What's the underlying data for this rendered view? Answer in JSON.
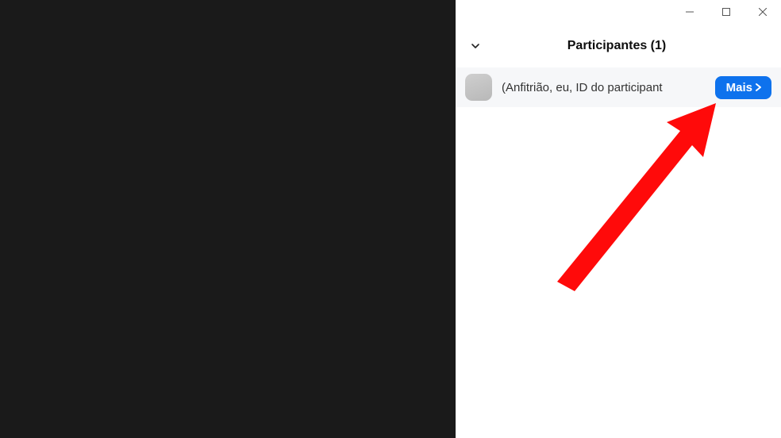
{
  "panel": {
    "title": "Participantes (1)"
  },
  "participants": [
    {
      "label": "(Anfitrião, eu, ID do participant",
      "action_label": "Mais"
    }
  ],
  "colors": {
    "accent": "#0e72ed",
    "annotation": "#ff0000",
    "video_bg": "#1a1a1a"
  }
}
